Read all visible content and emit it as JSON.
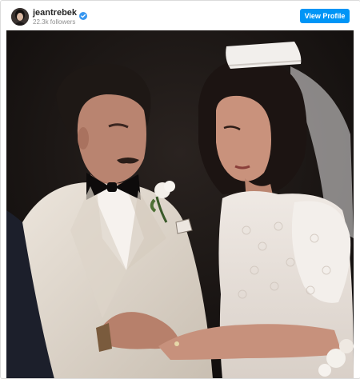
{
  "post": {
    "username": "jeantrebek",
    "followers": "22.3k followers",
    "view_profile_label": "View Profile"
  },
  "icons": {
    "avatar": "profile-photo",
    "verified": "verified-badge-icon"
  },
  "colors": {
    "button": "#0095f6",
    "verified": "#3897f0",
    "username": "#262626",
    "secondary_text": "#8e8e8e"
  }
}
